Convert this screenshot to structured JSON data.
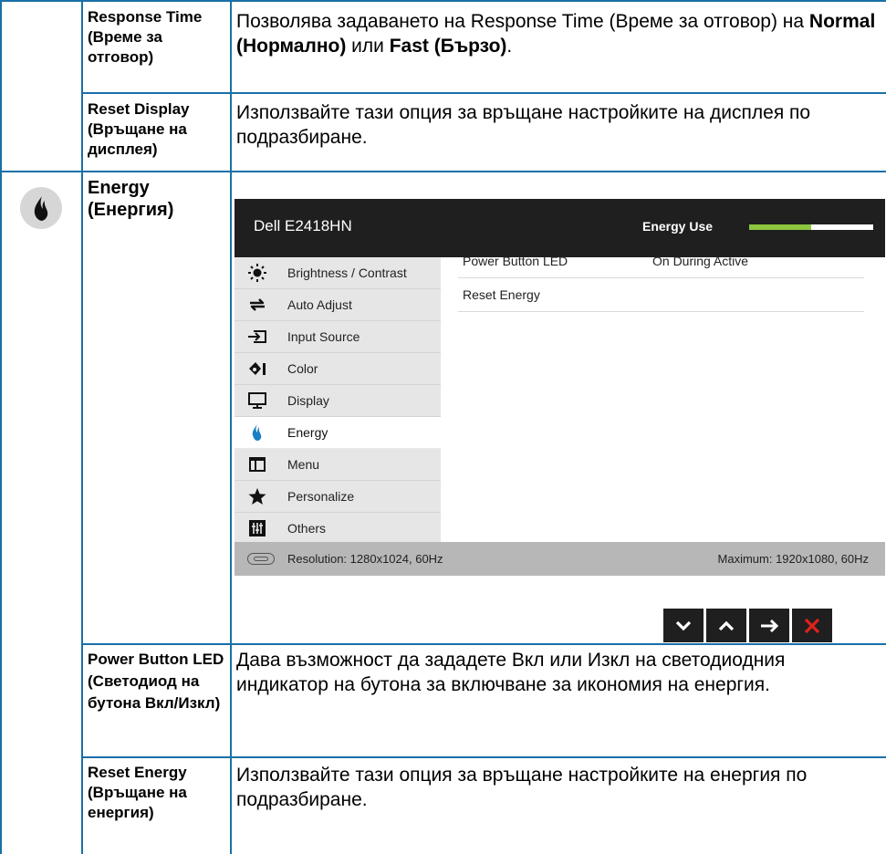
{
  "rows": {
    "response_time": {
      "label": "Response Time (Време за отговор)",
      "desc_prefix": "Позволява задаването на Response Time (Време за отговор) на ",
      "desc_bold1": "Normal (Нормално)",
      "desc_mid": " или ",
      "desc_bold2": "Fast (Бързо)",
      "desc_suffix": "."
    },
    "reset_display": {
      "label": "Reset Display (Връщане на дисплея)",
      "desc": "Използвайте тази опция за връщане настройките на дисплея по подразбиране."
    },
    "energy": {
      "label": "Energy (Енергия)",
      "icon": "flame-icon"
    },
    "power_button_led": {
      "label": "Power Button LED (Светодиод на бутона Вкл/Изкл)",
      "desc": "Дава възможност да зададете Вкл или Изкл на светодиодния индикатор на бутона за включване за икономия на енергия."
    },
    "reset_energy": {
      "label": "Reset Energy (Връщане на енергия)",
      "desc": "Използвайте тази опция за връщане настройките на енергия по подразбиране."
    }
  },
  "osd": {
    "model": "Dell E2418HN",
    "energy_use_label": "Energy Use",
    "energy_use_level": 0.5,
    "menu": [
      {
        "label": "Brightness / Contrast",
        "icon": "sun-icon"
      },
      {
        "label": "Auto Adjust",
        "icon": "auto-adjust-icon"
      },
      {
        "label": "Input Source",
        "icon": "input-source-icon"
      },
      {
        "label": "Color",
        "icon": "color-icon"
      },
      {
        "label": "Display",
        "icon": "display-icon"
      },
      {
        "label": "Energy",
        "icon": "energy-icon",
        "active": true
      },
      {
        "label": "Menu",
        "icon": "menu-icon"
      },
      {
        "label": "Personalize",
        "icon": "star-icon"
      },
      {
        "label": "Others",
        "icon": "others-icon"
      }
    ],
    "submenu": [
      {
        "label": "Power Button LED",
        "value": "On During Active"
      },
      {
        "label": "Reset Energy",
        "value": ""
      }
    ],
    "footer": {
      "resolution": "Resolution: 1280x1024, 60Hz",
      "maximum": "Maximum: 1920x1080, 60Hz"
    },
    "nav_buttons": [
      "down",
      "up",
      "right",
      "exit"
    ],
    "colors": {
      "header": "#1f1f1f",
      "accent": "#8dc63f",
      "exit": "#e0211c"
    }
  }
}
